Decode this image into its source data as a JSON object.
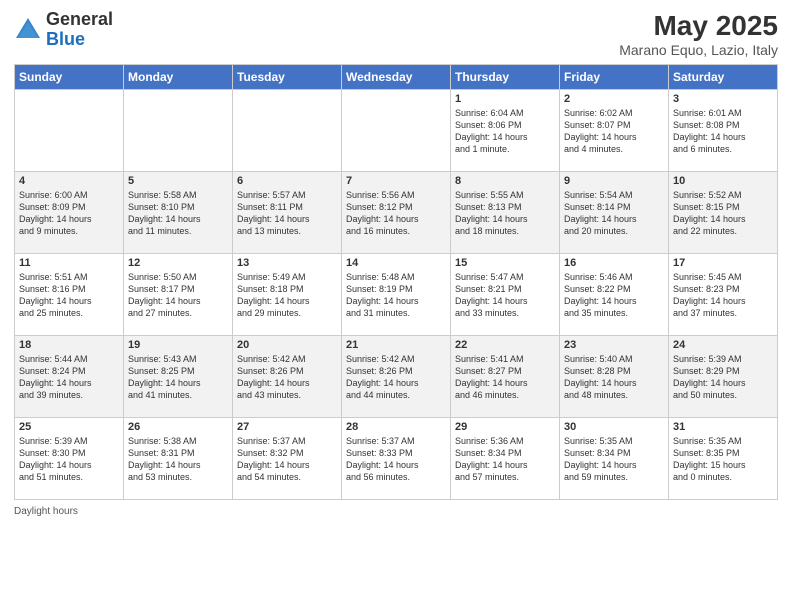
{
  "header": {
    "logo_general": "General",
    "logo_blue": "Blue",
    "main_title": "May 2025",
    "subtitle": "Marano Equo, Lazio, Italy"
  },
  "days_of_week": [
    "Sunday",
    "Monday",
    "Tuesday",
    "Wednesday",
    "Thursday",
    "Friday",
    "Saturday"
  ],
  "footer_text": "Daylight hours",
  "weeks": [
    [
      {
        "day": "",
        "content": ""
      },
      {
        "day": "",
        "content": ""
      },
      {
        "day": "",
        "content": ""
      },
      {
        "day": "",
        "content": ""
      },
      {
        "day": "1",
        "content": "Sunrise: 6:04 AM\nSunset: 8:06 PM\nDaylight: 14 hours\nand 1 minute."
      },
      {
        "day": "2",
        "content": "Sunrise: 6:02 AM\nSunset: 8:07 PM\nDaylight: 14 hours\nand 4 minutes."
      },
      {
        "day": "3",
        "content": "Sunrise: 6:01 AM\nSunset: 8:08 PM\nDaylight: 14 hours\nand 6 minutes."
      }
    ],
    [
      {
        "day": "4",
        "content": "Sunrise: 6:00 AM\nSunset: 8:09 PM\nDaylight: 14 hours\nand 9 minutes."
      },
      {
        "day": "5",
        "content": "Sunrise: 5:58 AM\nSunset: 8:10 PM\nDaylight: 14 hours\nand 11 minutes."
      },
      {
        "day": "6",
        "content": "Sunrise: 5:57 AM\nSunset: 8:11 PM\nDaylight: 14 hours\nand 13 minutes."
      },
      {
        "day": "7",
        "content": "Sunrise: 5:56 AM\nSunset: 8:12 PM\nDaylight: 14 hours\nand 16 minutes."
      },
      {
        "day": "8",
        "content": "Sunrise: 5:55 AM\nSunset: 8:13 PM\nDaylight: 14 hours\nand 18 minutes."
      },
      {
        "day": "9",
        "content": "Sunrise: 5:54 AM\nSunset: 8:14 PM\nDaylight: 14 hours\nand 20 minutes."
      },
      {
        "day": "10",
        "content": "Sunrise: 5:52 AM\nSunset: 8:15 PM\nDaylight: 14 hours\nand 22 minutes."
      }
    ],
    [
      {
        "day": "11",
        "content": "Sunrise: 5:51 AM\nSunset: 8:16 PM\nDaylight: 14 hours\nand 25 minutes."
      },
      {
        "day": "12",
        "content": "Sunrise: 5:50 AM\nSunset: 8:17 PM\nDaylight: 14 hours\nand 27 minutes."
      },
      {
        "day": "13",
        "content": "Sunrise: 5:49 AM\nSunset: 8:18 PM\nDaylight: 14 hours\nand 29 minutes."
      },
      {
        "day": "14",
        "content": "Sunrise: 5:48 AM\nSunset: 8:19 PM\nDaylight: 14 hours\nand 31 minutes."
      },
      {
        "day": "15",
        "content": "Sunrise: 5:47 AM\nSunset: 8:21 PM\nDaylight: 14 hours\nand 33 minutes."
      },
      {
        "day": "16",
        "content": "Sunrise: 5:46 AM\nSunset: 8:22 PM\nDaylight: 14 hours\nand 35 minutes."
      },
      {
        "day": "17",
        "content": "Sunrise: 5:45 AM\nSunset: 8:23 PM\nDaylight: 14 hours\nand 37 minutes."
      }
    ],
    [
      {
        "day": "18",
        "content": "Sunrise: 5:44 AM\nSunset: 8:24 PM\nDaylight: 14 hours\nand 39 minutes."
      },
      {
        "day": "19",
        "content": "Sunrise: 5:43 AM\nSunset: 8:25 PM\nDaylight: 14 hours\nand 41 minutes."
      },
      {
        "day": "20",
        "content": "Sunrise: 5:42 AM\nSunset: 8:26 PM\nDaylight: 14 hours\nand 43 minutes."
      },
      {
        "day": "21",
        "content": "Sunrise: 5:42 AM\nSunset: 8:26 PM\nDaylight: 14 hours\nand 44 minutes."
      },
      {
        "day": "22",
        "content": "Sunrise: 5:41 AM\nSunset: 8:27 PM\nDaylight: 14 hours\nand 46 minutes."
      },
      {
        "day": "23",
        "content": "Sunrise: 5:40 AM\nSunset: 8:28 PM\nDaylight: 14 hours\nand 48 minutes."
      },
      {
        "day": "24",
        "content": "Sunrise: 5:39 AM\nSunset: 8:29 PM\nDaylight: 14 hours\nand 50 minutes."
      }
    ],
    [
      {
        "day": "25",
        "content": "Sunrise: 5:39 AM\nSunset: 8:30 PM\nDaylight: 14 hours\nand 51 minutes."
      },
      {
        "day": "26",
        "content": "Sunrise: 5:38 AM\nSunset: 8:31 PM\nDaylight: 14 hours\nand 53 minutes."
      },
      {
        "day": "27",
        "content": "Sunrise: 5:37 AM\nSunset: 8:32 PM\nDaylight: 14 hours\nand 54 minutes."
      },
      {
        "day": "28",
        "content": "Sunrise: 5:37 AM\nSunset: 8:33 PM\nDaylight: 14 hours\nand 56 minutes."
      },
      {
        "day": "29",
        "content": "Sunrise: 5:36 AM\nSunset: 8:34 PM\nDaylight: 14 hours\nand 57 minutes."
      },
      {
        "day": "30",
        "content": "Sunrise: 5:35 AM\nSunset: 8:34 PM\nDaylight: 14 hours\nand 59 minutes."
      },
      {
        "day": "31",
        "content": "Sunrise: 5:35 AM\nSunset: 8:35 PM\nDaylight: 15 hours\nand 0 minutes."
      }
    ]
  ]
}
